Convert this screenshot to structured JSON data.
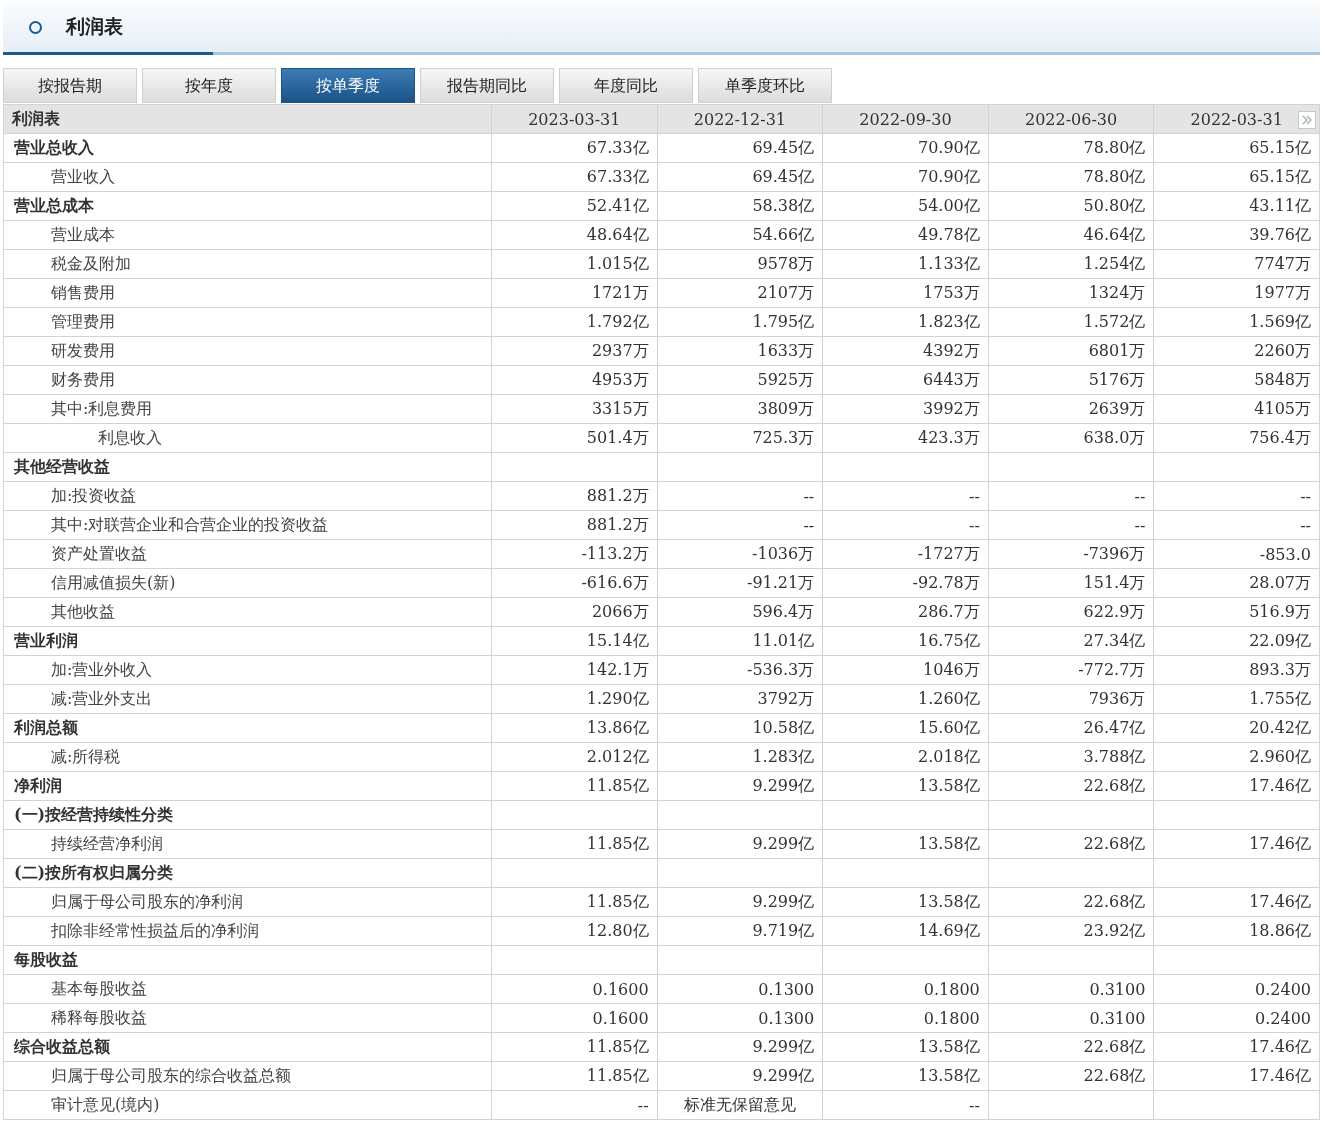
{
  "title": "利润表",
  "tabs": [
    {
      "label": "按报告期",
      "selected": false
    },
    {
      "label": "按年度",
      "selected": false
    },
    {
      "label": "按单季度",
      "selected": true
    },
    {
      "label": "报告期同比",
      "selected": false
    },
    {
      "label": "年度同比",
      "selected": false
    },
    {
      "label": "单季度环比",
      "selected": false
    }
  ],
  "table": {
    "columns": [
      "利润表",
      "2023-03-31",
      "2022-12-31",
      "2022-09-30",
      "2022-06-30",
      "2022-03-31"
    ],
    "rows": [
      {
        "kind": "group",
        "cells": [
          "营业总收入",
          "67.33亿",
          "69.45亿",
          "70.90亿",
          "78.80亿",
          "65.15亿"
        ]
      },
      {
        "kind": "item",
        "cells": [
          "营业收入",
          "67.33亿",
          "69.45亿",
          "70.90亿",
          "78.80亿",
          "65.15亿"
        ]
      },
      {
        "kind": "group",
        "cells": [
          "营业总成本",
          "52.41亿",
          "58.38亿",
          "54.00亿",
          "50.80亿",
          "43.11亿"
        ]
      },
      {
        "kind": "item",
        "cells": [
          "营业成本",
          "48.64亿",
          "54.66亿",
          "49.78亿",
          "46.64亿",
          "39.76亿"
        ]
      },
      {
        "kind": "item",
        "cells": [
          "税金及附加",
          "1.015亿",
          "9578万",
          "1.133亿",
          "1.254亿",
          "7747万"
        ]
      },
      {
        "kind": "item",
        "cells": [
          "销售费用",
          "1721万",
          "2107万",
          "1753万",
          "1324万",
          "1977万"
        ]
      },
      {
        "kind": "item",
        "cells": [
          "管理费用",
          "1.792亿",
          "1.795亿",
          "1.823亿",
          "1.572亿",
          "1.569亿"
        ]
      },
      {
        "kind": "item",
        "cells": [
          "研发费用",
          "2937万",
          "1633万",
          "4392万",
          "6801万",
          "2260万"
        ]
      },
      {
        "kind": "item",
        "cells": [
          "财务费用",
          "4953万",
          "5925万",
          "6443万",
          "5176万",
          "5848万"
        ]
      },
      {
        "kind": "item",
        "cells": [
          "其中:利息费用",
          "3315万",
          "3809万",
          "3992万",
          "2639万",
          "4105万"
        ]
      },
      {
        "kind": "subitem",
        "cells": [
          "利息收入",
          "501.4万",
          "725.3万",
          "423.3万",
          "638.0万",
          "756.4万"
        ]
      },
      {
        "kind": "group",
        "cells": [
          "其他经营收益",
          "",
          "",
          "",
          "",
          ""
        ]
      },
      {
        "kind": "item",
        "cells": [
          "加:投资收益",
          "881.2万",
          "--",
          "--",
          "--",
          "--"
        ]
      },
      {
        "kind": "item",
        "cells": [
          "其中:对联营企业和合营企业的投资收益",
          "881.2万",
          "--",
          "--",
          "--",
          "--"
        ]
      },
      {
        "kind": "item",
        "cells": [
          "资产处置收益",
          "-113.2万",
          "-1036万",
          "-1727万",
          "-7396万",
          "-853.0"
        ]
      },
      {
        "kind": "item",
        "cells": [
          "信用减值损失(新)",
          "-616.6万",
          "-91.21万",
          "-92.78万",
          "151.4万",
          "28.07万"
        ]
      },
      {
        "kind": "item",
        "cells": [
          "其他收益",
          "2066万",
          "596.4万",
          "286.7万",
          "622.9万",
          "516.9万"
        ]
      },
      {
        "kind": "group",
        "cells": [
          "营业利润",
          "15.14亿",
          "11.01亿",
          "16.75亿",
          "27.34亿",
          "22.09亿"
        ]
      },
      {
        "kind": "item",
        "cells": [
          "加:营业外收入",
          "142.1万",
          "-536.3万",
          "1046万",
          "-772.7万",
          "893.3万"
        ]
      },
      {
        "kind": "item",
        "cells": [
          "减:营业外支出",
          "1.290亿",
          "3792万",
          "1.260亿",
          "7936万",
          "1.755亿"
        ]
      },
      {
        "kind": "group",
        "cells": [
          "利润总额",
          "13.86亿",
          "10.58亿",
          "15.60亿",
          "26.47亿",
          "20.42亿"
        ]
      },
      {
        "kind": "item",
        "cells": [
          "减:所得税",
          "2.012亿",
          "1.283亿",
          "2.018亿",
          "3.788亿",
          "2.960亿"
        ]
      },
      {
        "kind": "group",
        "cells": [
          "净利润",
          "11.85亿",
          "9.299亿",
          "13.58亿",
          "22.68亿",
          "17.46亿"
        ]
      },
      {
        "kind": "group",
        "cells": [
          "(一)按经营持续性分类",
          "",
          "",
          "",
          "",
          ""
        ]
      },
      {
        "kind": "item",
        "cells": [
          "持续经营净利润",
          "11.85亿",
          "9.299亿",
          "13.58亿",
          "22.68亿",
          "17.46亿"
        ]
      },
      {
        "kind": "group",
        "cells": [
          "(二)按所有权归属分类",
          "",
          "",
          "",
          "",
          ""
        ]
      },
      {
        "kind": "item",
        "cells": [
          "归属于母公司股东的净利润",
          "11.85亿",
          "9.299亿",
          "13.58亿",
          "22.68亿",
          "17.46亿"
        ]
      },
      {
        "kind": "item",
        "cells": [
          "扣除非经常性损益后的净利润",
          "12.80亿",
          "9.719亿",
          "14.69亿",
          "23.92亿",
          "18.86亿"
        ]
      },
      {
        "kind": "group",
        "cells": [
          "每股收益",
          "",
          "",
          "",
          "",
          ""
        ]
      },
      {
        "kind": "item",
        "cells": [
          "基本每股收益",
          "0.1600",
          "0.1300",
          "0.1800",
          "0.3100",
          "0.2400"
        ]
      },
      {
        "kind": "item",
        "cells": [
          "稀释每股收益",
          "0.1600",
          "0.1300",
          "0.1800",
          "0.3100",
          "0.2400"
        ]
      },
      {
        "kind": "group",
        "cells": [
          "综合收益总额",
          "11.85亿",
          "9.299亿",
          "13.58亿",
          "22.68亿",
          "17.46亿"
        ]
      },
      {
        "kind": "item",
        "cells": [
          "归属于母公司股东的综合收益总额",
          "11.85亿",
          "9.299亿",
          "13.58亿",
          "22.68亿",
          "17.46亿"
        ]
      },
      {
        "kind": "item",
        "cells": [
          "审计意见(境内)",
          "--",
          "标准无保留意见",
          "--",
          "",
          ""
        ]
      }
    ]
  }
}
